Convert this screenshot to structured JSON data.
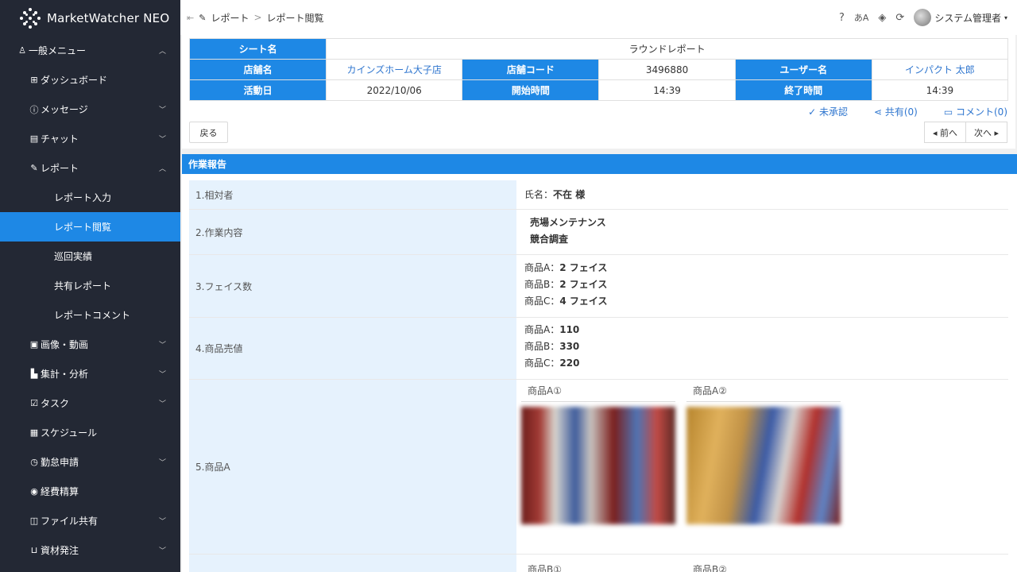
{
  "app": {
    "name": "MarketWatcher NEO"
  },
  "sidebar": {
    "items": [
      {
        "label": "一般メニュー",
        "icon": "people-icon",
        "level": 0,
        "chevron": "up"
      },
      {
        "label": "ダッシュボード",
        "icon": "grid-icon",
        "level": 1,
        "chevron": ""
      },
      {
        "label": "メッセージ",
        "icon": "info-icon",
        "level": 1,
        "chevron": "down"
      },
      {
        "label": "チャット",
        "icon": "chat-icon",
        "level": 1,
        "chevron": "down"
      },
      {
        "label": "レポート",
        "icon": "pencil-icon",
        "level": 1,
        "chevron": "up"
      },
      {
        "label": "レポート入力",
        "icon": "",
        "level": 2,
        "chevron": ""
      },
      {
        "label": "レポート閲覧",
        "icon": "",
        "level": 2,
        "chevron": "",
        "active": true
      },
      {
        "label": "巡回実績",
        "icon": "",
        "level": 2,
        "chevron": ""
      },
      {
        "label": "共有レポート",
        "icon": "",
        "level": 2,
        "chevron": ""
      },
      {
        "label": "レポートコメント",
        "icon": "",
        "level": 2,
        "chevron": ""
      },
      {
        "label": "画像・動画",
        "icon": "image-icon",
        "level": 1,
        "chevron": "down"
      },
      {
        "label": "集計・分析",
        "icon": "chart-icon",
        "level": 1,
        "chevron": "down"
      },
      {
        "label": "タスク",
        "icon": "task-icon",
        "level": 1,
        "chevron": "down"
      },
      {
        "label": "スケジュール",
        "icon": "calendar-icon",
        "level": 1,
        "chevron": ""
      },
      {
        "label": "勤怠申請",
        "icon": "clock-icon",
        "level": 1,
        "chevron": "down"
      },
      {
        "label": "経費精算",
        "icon": "coin-icon",
        "level": 1,
        "chevron": ""
      },
      {
        "label": "ファイル共有",
        "icon": "folder-icon",
        "level": 1,
        "chevron": "down"
      },
      {
        "label": "資材発注",
        "icon": "cart-icon",
        "level": 1,
        "chevron": "down"
      }
    ]
  },
  "breadcrumb": {
    "section": "レポート",
    "separator": ">",
    "page": "レポート閲覧"
  },
  "topbar": {
    "user": "システム管理者"
  },
  "report": {
    "sheet_label": "シート名",
    "sheet_value": "ラウンドレポート",
    "store_label": "店舗名",
    "store_value": "カインズホーム大子店",
    "code_label": "店舗コード",
    "code_value": "3496880",
    "user_label": "ユーザー名",
    "user_value": "インパクト 太郎",
    "date_label": "活動日",
    "date_value": "2022/10/06",
    "start_label": "開始時間",
    "start_value": "14:39",
    "end_label": "終了時間",
    "end_value": "14:39"
  },
  "actions": {
    "approve": "✓ 未承認",
    "share": "共有(0)",
    "comment": "コメント(0)"
  },
  "buttons": {
    "back": "戻る",
    "prev": "◂ 前へ",
    "next": "次へ ▸"
  },
  "section": {
    "title": "作業報告"
  },
  "rows": {
    "r1_label": "1.相対者",
    "r1_prefix": "氏名：",
    "r1_value": "不在 様",
    "r2_label": "2.作業内容",
    "r2_line1": "売場メンテナンス",
    "r2_line2": "競合調査",
    "r3_label": "3.フェイス数",
    "r3_a_prefix": "商品A：",
    "r3_a_value": "2 フェイス",
    "r3_b_prefix": "商品B：",
    "r3_b_value": "2 フェイス",
    "r3_c_prefix": "商品C：",
    "r3_c_value": "4 フェイス",
    "r4_label": "4.商品売値",
    "r4_a_prefix": "商品A：",
    "r4_a_value": "110",
    "r4_b_prefix": "商品B：",
    "r4_b_value": "330",
    "r4_c_prefix": "商品C：",
    "r4_c_value": "220",
    "r5_label": "5.商品A",
    "r5_cap1": "商品A①",
    "r5_cap2": "商品A②",
    "r6_cap1": "商品B①",
    "r6_cap2": "商品B②"
  }
}
